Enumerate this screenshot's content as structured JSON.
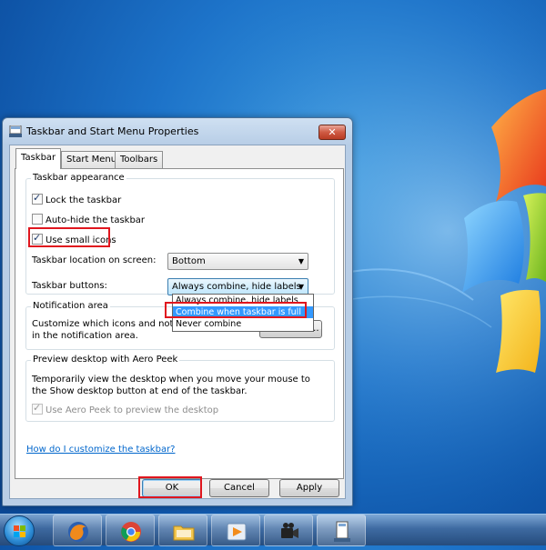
{
  "window": {
    "title": "Taskbar and Start Menu Properties",
    "close_glyph": "✕"
  },
  "tabs": [
    {
      "label": "Taskbar",
      "active": true
    },
    {
      "label": "Start Menu",
      "active": false
    },
    {
      "label": "Toolbars",
      "active": false
    }
  ],
  "appearance": {
    "group_title": "Taskbar appearance",
    "lock_label": "Lock the taskbar",
    "lock_checked": true,
    "autohide_label": "Auto-hide the taskbar",
    "autohide_checked": false,
    "small_icons_label": "Use small icons",
    "small_icons_checked": true,
    "location_label": "Taskbar location on screen:",
    "location_value": "Bottom",
    "buttons_label": "Taskbar buttons:",
    "buttons_value": "Always combine, hide labels",
    "buttons_options": [
      "Always combine, hide labels",
      "Combine when taskbar is full",
      "Never combine"
    ],
    "buttons_highlighted_option": "Combine when taskbar is full"
  },
  "notification": {
    "group_title": "Notification area",
    "description": "Customize which icons and notifications appear in the notification area.",
    "customize_button": "Customize..."
  },
  "aero": {
    "group_title": "Preview desktop with Aero Peek",
    "description": "Temporarily view the desktop when you move your mouse to the Show desktop button at end of the taskbar.",
    "checkbox_label": "Use Aero Peek to preview the desktop",
    "checkbox_checked": true
  },
  "help_link": "How do I customize the taskbar?",
  "buttons": {
    "ok": "OK",
    "cancel": "Cancel",
    "apply": "Apply"
  },
  "taskbar": {
    "items": [
      "firefox-icon",
      "chrome-icon",
      "folder-icon",
      "media-player-icon",
      "camcorder-icon",
      "taskbar-properties-icon"
    ]
  },
  "colors": {
    "highlight_box": "#e0161e",
    "selection": "#3399ff",
    "desktop": "#1d73c9"
  }
}
